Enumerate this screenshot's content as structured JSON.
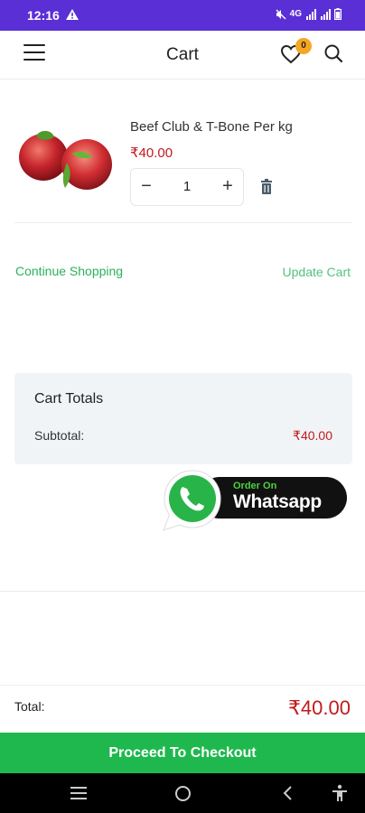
{
  "status_bar": {
    "time": "12:16",
    "network": "4G"
  },
  "header": {
    "title": "Cart",
    "wishlist_count": "0"
  },
  "cart": {
    "items": [
      {
        "name": "Beef Club & T-Bone Per kg",
        "price": "₹40.00",
        "quantity": "1",
        "minus_label": "−",
        "plus_label": "+"
      }
    ],
    "continue_label": "Continue Shopping",
    "update_label": "Update Cart"
  },
  "totals": {
    "title": "Cart Totals",
    "subtotal_label": "Subtotal:",
    "subtotal_value": "₹40.00"
  },
  "whatsapp": {
    "order_label": "Order On",
    "brand_label": "Whatsapp"
  },
  "footer": {
    "total_label": "Total:",
    "total_value": "₹40.00",
    "checkout_label": "Proceed To Checkout"
  },
  "colors": {
    "status_bar": "#5b2fd6",
    "accent_green": "#1fb84e",
    "price_red": "#c21a1a",
    "badge_orange": "#f5a623"
  },
  "icons": [
    "menu-icon",
    "heart-icon",
    "search-icon",
    "trash-icon",
    "whatsapp-icon",
    "nav-menu-icon",
    "nav-home-icon",
    "nav-back-icon",
    "accessibility-icon"
  ]
}
